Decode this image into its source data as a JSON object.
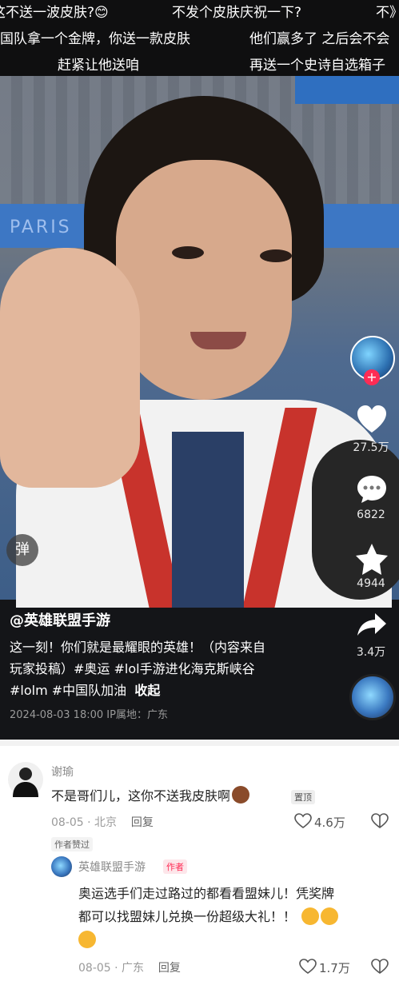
{
  "danmaku": {
    "row1": [
      "这不送一波皮肤?😊",
      "不发个皮肤庆祝一下?",
      "不》"
    ],
    "row2": [
      "国队拿一个金牌，你送一款皮肤",
      "他们赢多了 之后会不会"
    ],
    "row3": [
      "赶紧让他送咱",
      "再送一个史诗自选箱子"
    ]
  },
  "video": {
    "background_text": "PARIS",
    "danmu_toggle": "弹"
  },
  "sidebar": {
    "likes": "27.5万",
    "comments": "6822",
    "favorites": "4944",
    "shares": "3.4万"
  },
  "post": {
    "author": "@英雄联盟手游",
    "caption_line1": "这一刻！你们就是最耀眼的英雄！（内容来自",
    "caption_line2": "玩家投稿）#奥运 #lol手游进化海克斯峡谷",
    "caption_line3": "#lolm #中国队加油",
    "fold": "收起",
    "meta": "2024-08-03 18:00  IP属地：广东"
  },
  "comment1": {
    "user": "谢瑜",
    "text": "不是哥们儿，这你不送我皮肤啊",
    "pin": "置顶",
    "date": "08-05",
    "location": "北京",
    "reply": "回复",
    "likes": "4.6万",
    "author_liked": "作者赞过"
  },
  "reply1": {
    "user": "英雄联盟手游",
    "badge": "作者",
    "line1": "奥运选手们走过路过的都看看盟妹儿！凭奖牌",
    "line2": "都可以找盟妹儿兑换一份超级大礼！！",
    "date": "08-05",
    "location": "广东",
    "reply": "回复",
    "likes": "1.7万"
  },
  "colors": {
    "accent": "#fe2c55",
    "video_bg": "#141518",
    "pin_bg": "#eeeeee",
    "author_badge": "#fe2c55"
  }
}
